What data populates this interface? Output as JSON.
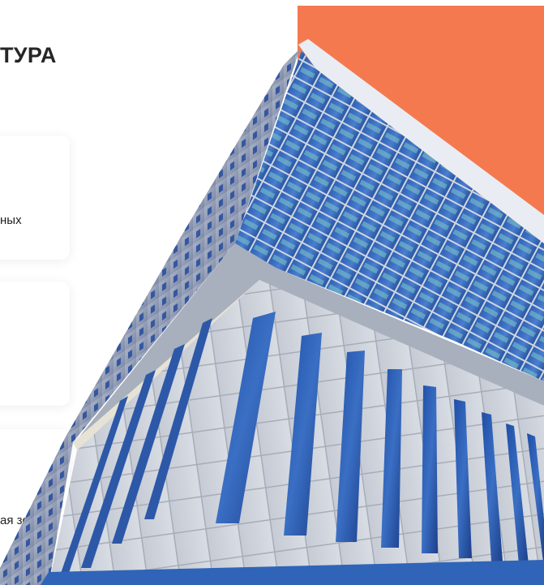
{
  "section": {
    "heading": "ТУРА"
  },
  "cards": [
    {
      "text": "ных"
    },
    {
      "text": ""
    },
    {
      "text": "ая зона"
    }
  ],
  "colors": {
    "accent": "#f5794f",
    "card_bg": "#ffffff",
    "glass": "#2f5fb0",
    "cladding": "#c7ccd6"
  }
}
